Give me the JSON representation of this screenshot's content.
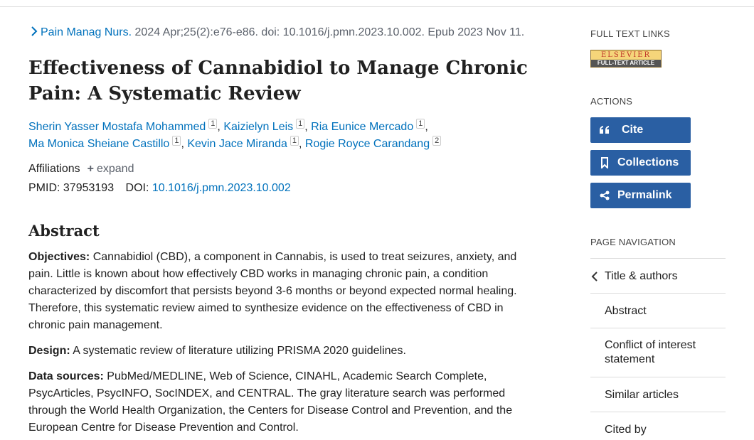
{
  "citation": {
    "journal": "Pain Manag Nurs.",
    "details": "2024 Apr;25(2):e76-e86. doi: 10.1016/j.pmn.2023.10.002. Epub 2023 Nov 11."
  },
  "title": "Effectiveness of Cannabidiol to Manage Chronic Pain: A Systematic Review",
  "authors": [
    {
      "name": "Sherin Yasser Mostafa Mohammed",
      "aff": "1"
    },
    {
      "name": "Kaizielyn Leis",
      "aff": "1"
    },
    {
      "name": "Ria Eunice Mercado",
      "aff": "1"
    },
    {
      "name": "Ma Monica Sheiane Castillo",
      "aff": "1"
    },
    {
      "name": "Kevin Jace Miranda",
      "aff": "1"
    },
    {
      "name": "Rogie Royce Carandang",
      "aff": "2"
    }
  ],
  "affiliations": {
    "label": "Affiliations",
    "expand": "expand"
  },
  "ids": {
    "pmid_label": "PMID:",
    "pmid": "37953193",
    "doi_label": "DOI:",
    "doi": "10.1016/j.pmn.2023.10.002"
  },
  "abstract": {
    "heading": "Abstract",
    "objectives_label": "Objectives:",
    "objectives": "Cannabidiol (CBD), a component in Cannabis, is used to treat seizures, anxiety, and pain. Little is known about how effectively CBD works in managing chronic pain, a condition characterized by discomfort that persists beyond 3-6 months or beyond expected normal healing. Therefore, this systematic review aimed to synthesize evidence on the effectiveness of CBD in chronic pain management.",
    "design_label": "Design:",
    "design": "A systematic review of literature utilizing PRISMA 2020 guidelines.",
    "sources_label": "Data sources:",
    "sources": "PubMed/MEDLINE, Web of Science, CINAHL, Academic Search Complete, PsycArticles, PsycINFO, SocINDEX, and CENTRAL. The gray literature search was performed through the World Health Organization, the Centers for Disease Control and Prevention, and the European Centre for Disease Prevention and Control."
  },
  "sidebar": {
    "full_text_label": "FULL TEXT LINKS",
    "elsevier_top": "ELSEVIER",
    "elsevier_bottom": "FULL-TEXT ARTICLE",
    "actions_label": "ACTIONS",
    "cite": "Cite",
    "collections": "Collections",
    "permalink": "Permalink",
    "page_nav_label": "PAGE NAVIGATION",
    "nav": [
      "Title & authors",
      "Abstract",
      "Conflict of interest statement",
      "Similar articles",
      "Cited by"
    ]
  },
  "colors": {
    "link": "#0071bc",
    "button": "#2a5fa3"
  }
}
